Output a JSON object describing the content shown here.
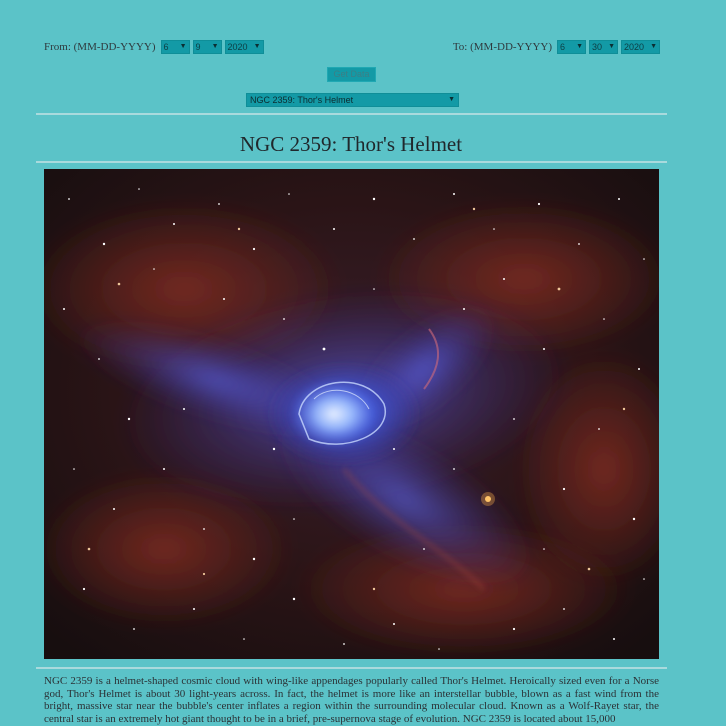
{
  "filters": {
    "from": {
      "label": "From: (MM-DD-YYYY)",
      "month": "6",
      "day": "9",
      "year": "2020"
    },
    "to": {
      "label": "To: (MM-DD-YYYY)",
      "month": "6",
      "day": "30",
      "year": "2020"
    },
    "get_data_label": "Get Data",
    "selected_item": "NGC 2359: Thor's Helmet"
  },
  "article": {
    "title": "NGC 2359: Thor's Helmet",
    "image_subject": "nebula-image",
    "description": "NGC 2359 is a helmet-shaped cosmic cloud with wing-like appendages popularly called Thor's Helmet. Heroically sized even for a Norse god, Thor's Helmet is about 30 light-years across. In fact, the helmet is more like an interstellar bubble, blown as a fast wind from the bright, massive star near the bubble's center inflates a region within the surrounding molecular cloud. Known as a Wolf-Rayet star, the central star is an extremely hot giant thought to be in a brief, pre-supernova stage of evolution. NGC 2359 is located about 15,000"
  },
  "colors": {
    "background": "#5bc3c8",
    "control": "#139aa6",
    "rule": "#a9dadd"
  }
}
